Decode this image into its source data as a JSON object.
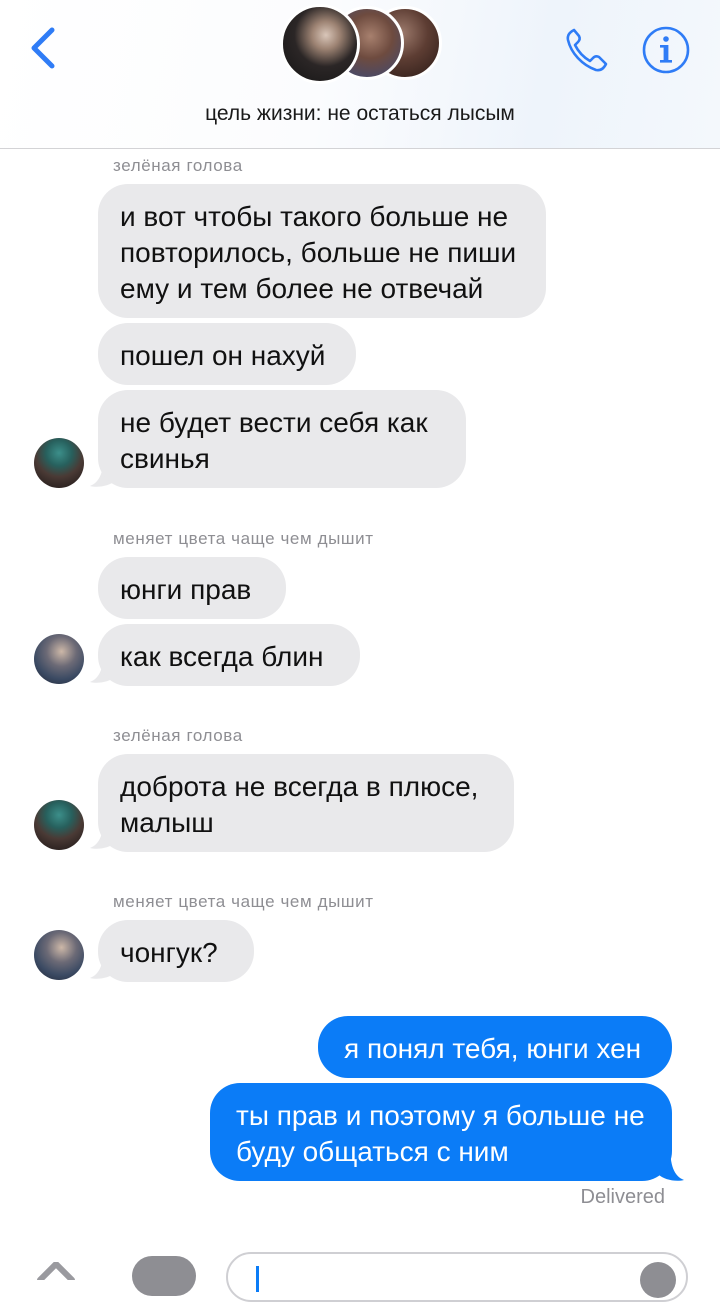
{
  "header": {
    "title": "цель жизни: не остаться лысым",
    "back_icon": "chevron-left-icon",
    "call_icon": "phone-icon",
    "info_icon": "info-icon"
  },
  "colors": {
    "accent": "#2f7cf6",
    "outgoing_bubble": "#0b7cf7",
    "incoming_bubble": "#e9e9eb",
    "meta_text": "#8e8e93"
  },
  "messages": {
    "group1": {
      "sender": "зелёная голова",
      "m1_l1": "и вот чтобы такого больше не",
      "m1_l2": "повторилось, больше не пиши",
      "m1_l3": "ему и тем более не отвечай",
      "m2": "пошел он нахуй",
      "m3_l1": "не будет вести себя как",
      "m3_l2": "свинья"
    },
    "group2": {
      "sender": "меняет цвета чаще чем дышит",
      "m1": "юнги прав",
      "m2": "как всегда блин"
    },
    "group3": {
      "sender": "зелёная голова",
      "m1_l1": "доброта не всегда в плюсе,",
      "m1_l2": "малыш"
    },
    "group4": {
      "sender": "меняет цвета чаще чем дышит",
      "m1": "чонгук?"
    },
    "outgoing": {
      "m1": "я понял тебя, юнги хен",
      "m2_l1": "ты прав и поэтому я больше не",
      "m2_l2": "буду общаться с ним"
    },
    "status": "Delivered"
  }
}
